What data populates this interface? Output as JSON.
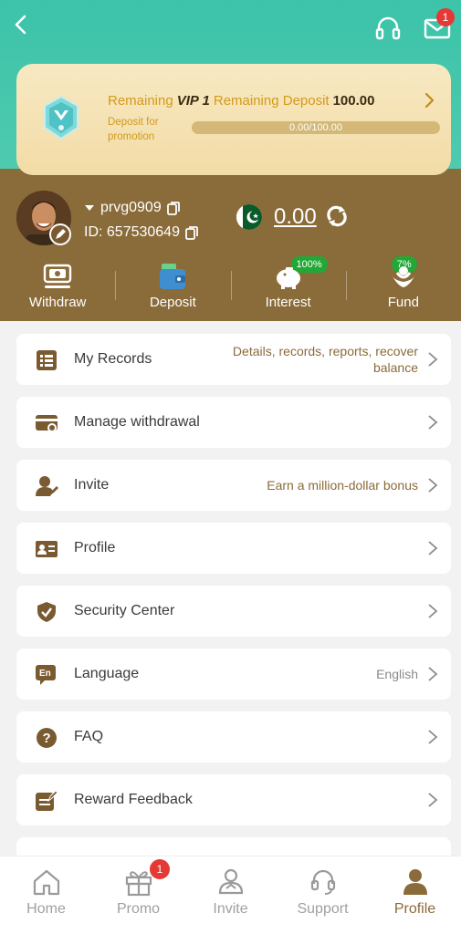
{
  "header": {
    "back_icon": "chevron-left-icon",
    "support_icon": "headset-icon",
    "mail_icon": "mail-icon",
    "mail_badge": "1"
  },
  "vip": {
    "remaining_label": "Remaining",
    "level": "VIP 1",
    "remaining_deposit_label": "Remaining Deposit",
    "deposit_value": "100.00",
    "sub_text": "Deposit for promotion",
    "progress_text": "0.00/100.00",
    "progress_fraction": 0.0
  },
  "user": {
    "username": "prvg0909",
    "id_text": "ID: 657530649",
    "balance": "0.00",
    "flag": "pakistan-flag-icon"
  },
  "actions": [
    {
      "label": "Withdraw",
      "icon": "withdraw-icon"
    },
    {
      "label": "Deposit",
      "icon": "wallet-icon"
    },
    {
      "label": "Interest",
      "icon": "piggy-bank-icon",
      "badge": "100%"
    },
    {
      "label": "Fund",
      "icon": "fund-hands-icon",
      "badge": "7%"
    }
  ],
  "menu": [
    {
      "label": "My Records",
      "detail": "Details, records, reports, recover balance",
      "icon": "records-icon"
    },
    {
      "label": "Manage withdrawal",
      "detail": "",
      "icon": "card-gear-icon"
    },
    {
      "label": "Invite",
      "detail": "Earn a million-dollar bonus",
      "icon": "user-edit-icon"
    },
    {
      "label": "Profile",
      "detail": "",
      "icon": "id-card-icon"
    },
    {
      "label": "Security Center",
      "detail": "",
      "icon": "shield-check-icon"
    },
    {
      "label": "Language",
      "detail": "English",
      "icon": "language-icon"
    },
    {
      "label": "FAQ",
      "detail": "",
      "icon": "question-icon"
    },
    {
      "label": "Reward Feedback",
      "detail": "",
      "icon": "feedback-icon"
    }
  ],
  "tabs": [
    {
      "label": "Home",
      "icon": "home-icon"
    },
    {
      "label": "Promo",
      "icon": "gift-icon",
      "badge": "1"
    },
    {
      "label": "Invite",
      "icon": "invite-icon"
    },
    {
      "label": "Support",
      "icon": "support-icon"
    },
    {
      "label": "Profile",
      "icon": "profile-icon",
      "active": true
    }
  ],
  "colors": {
    "teal": "#3cc3a9",
    "brown": "#8a6b3a",
    "gold_text": "#d39a18",
    "badge_red": "#e53935",
    "badge_green": "#22a836"
  }
}
